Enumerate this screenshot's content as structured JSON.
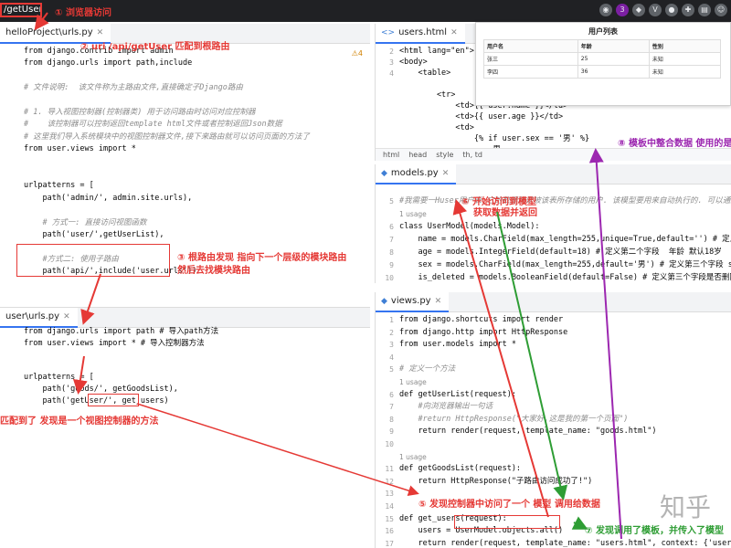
{
  "browser": {
    "url": "/getUser/"
  },
  "annotations": {
    "a1": {
      "num": "①",
      "text": "浏览器访问"
    },
    "a2": {
      "num": "②",
      "text": "uri /api/getUser 匹配到根路由"
    },
    "a3": {
      "num": "③",
      "text": "根路由发现 指向下一个层级的模块路由",
      "text2": "然后去找模块路由"
    },
    "a4": {
      "text": "匹配到了 发现是一个视图控制器的方法"
    },
    "a5": {
      "num": "⑤",
      "text": "发现控制器中访问了一个 模型 调用给数据"
    },
    "a6": {
      "num": "⑥",
      "text": "开始访问到模型",
      "text2": "获取数据并返回"
    },
    "a7": {
      "num": "⑦",
      "text": "发现调用了模板，并传入了模型"
    },
    "a8": {
      "num": "⑧",
      "text": "模板中整合数据 使用的是"
    }
  },
  "root_urls": {
    "tab": "helloProject\\urls.py",
    "warning": "⚠4",
    "lines": [
      {
        "t": "from django.contrib import admin"
      },
      {
        "t": "from django.urls import path,include"
      },
      {
        "t": ""
      },
      {
        "t": "# 文件说明:  该文件称为主路由文件,直接确定子Django路由"
      },
      {
        "t": ""
      },
      {
        "t": "# 1. 导入视图控制器(控制器类) 用于访问路由时访问对应控制器"
      },
      {
        "t": "#    该控制器可以控制返回template html文件或者控制返回Json数据"
      },
      {
        "t": "# 这里我们导入系统模块中的视图控制器文件,接下来路由就可以访问页面的方法了"
      },
      {
        "t": "from user.views import *"
      },
      {
        "t": ""
      },
      {
        "t": ""
      },
      {
        "t": "urlpatterns = ["
      },
      {
        "t": "    path('admin/', admin.site.urls),"
      },
      {
        "t": ""
      },
      {
        "t": "    # 方式一: 直接访问视图函数"
      },
      {
        "t": "    path('user/',getUserList),"
      },
      {
        "t": ""
      },
      {
        "t": "    #方式二: 使用子路由"
      },
      {
        "t": "    path('api/',include('user.urls'))"
      }
    ]
  },
  "user_urls": {
    "tab": "user\\urls.py",
    "lines": [
      {
        "t": "from django.urls import path # 导入path方法"
      },
      {
        "t": "from user.views import * # 导入控制器方法"
      },
      {
        "t": ""
      },
      {
        "t": ""
      },
      {
        "t": "urlpatterns = ["
      },
      {
        "t": "    path('goods/', getGoodsList),"
      },
      {
        "t": "    path('getUser/', get_users)"
      }
    ]
  },
  "users_html": {
    "tab": "users.html",
    "line_numbers": [
      "2",
      "3",
      "4",
      "",
      "",
      "",
      "",
      "",
      "",
      ""
    ],
    "lines": [
      {
        "t": "<html lang=\"en\">"
      },
      {
        "t": "<body>"
      },
      {
        "t": "    <table>"
      },
      {
        "t": ""
      },
      {
        "t": "        <tr>"
      },
      {
        "t": "            <td>{{ user.name }}</td>"
      },
      {
        "t": "            <td>{{ user.age }}</td>"
      },
      {
        "t": "            <td>"
      },
      {
        "t": "                {% if user.sex == '男' %}"
      },
      {
        "t": "                    男"
      }
    ],
    "breadcrumb": [
      "html",
      "head",
      "style",
      "th, td"
    ]
  },
  "preview": {
    "title": "用户列表",
    "headers": [
      "用户名",
      "年龄",
      "性别"
    ],
    "rows": [
      [
        "张三",
        "25",
        "未知"
      ],
      [
        "李四",
        "36",
        "未知"
      ]
    ]
  },
  "models_py": {
    "tab": "models.py",
    "lines": [
      {
        "n": "5",
        "t": "#我需要一Huser用户表,它的数据就是被该表所存储的用户. 该模型要用来自动执行的. 可以通过models中的工具来调用"
      },
      {
        "n": "",
        "t": "1 usage"
      },
      {
        "n": "6",
        "t": "class UserModel(models.Model):"
      },
      {
        "n": "7",
        "t": "    name = models.CharField(max_length=255,unique=True,default='') # 定义数据表中的"
      },
      {
        "n": "8",
        "t": "    age = models.IntegerField(default=18) # 定义第二个字段  年龄 默认18岁"
      },
      {
        "n": "9",
        "t": "    sex = models.CharField(max_length=255,default='男') # 定义第三个字段 sex 性别 默认"
      },
      {
        "n": "10",
        "t": "    is_deleted = models.BooleanField(default=False) # 定义第三个字段是否删除,默认为false"
      }
    ]
  },
  "views_py": {
    "tab": "views.py",
    "lines": [
      {
        "n": "1",
        "t": "from django.shortcuts import render"
      },
      {
        "n": "2",
        "t": "from django.http import HttpResponse"
      },
      {
        "n": "3",
        "t": "from user.models import *"
      },
      {
        "n": "4",
        "t": ""
      },
      {
        "n": "5",
        "t": "# 定义一个方法"
      },
      {
        "n": "",
        "t": "1 usage"
      },
      {
        "n": "6",
        "t": "def getUserList(request):"
      },
      {
        "n": "7",
        "t": "    #向浏览器输出一句话"
      },
      {
        "n": "8",
        "t": "    #return HttpResponse(\"大家好,这是我的第一个页面\")"
      },
      {
        "n": "9",
        "t": "    return render(request, template_name: \"goods.html\")"
      },
      {
        "n": "10",
        "t": ""
      },
      {
        "n": "",
        "t": "1 usage"
      },
      {
        "n": "11",
        "t": "def getGoodsList(request):"
      },
      {
        "n": "12",
        "t": "    return HttpResponse(\"子路由访问成功了!\")"
      },
      {
        "n": "13",
        "t": ""
      },
      {
        "n": "14",
        "t": ""
      },
      {
        "n": "15",
        "t": "def get_users(request):"
      },
      {
        "n": "16",
        "t": "    users = UserModel.objects.all()"
      },
      {
        "n": "17",
        "t": "    return render(request, template_name: \"users.html\", context: {'users':users})"
      }
    ],
    "usage_15": "1 usage"
  },
  "watermark": "知乎",
  "colors": {
    "accent_red": "#e53935",
    "purple": "#9c27b0",
    "green": "#2e9d34"
  }
}
